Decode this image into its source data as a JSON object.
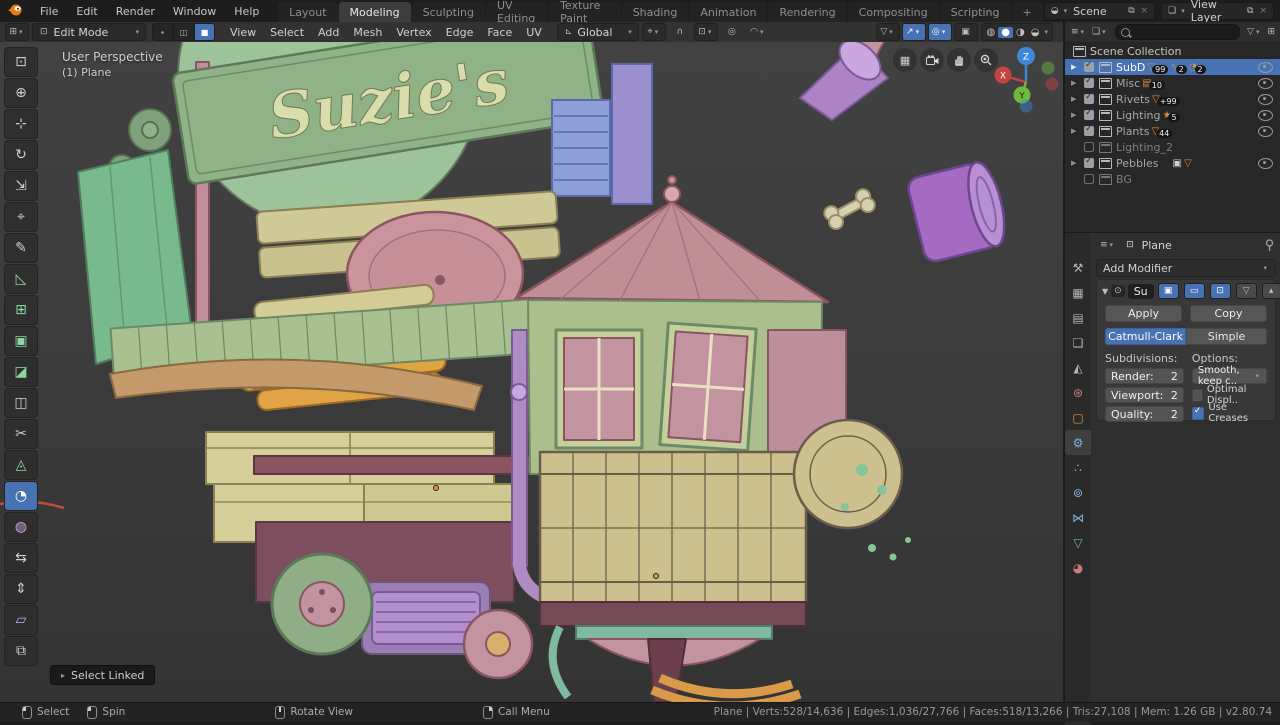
{
  "topbar": {
    "menus": [
      "File",
      "Edit",
      "Render",
      "Window",
      "Help"
    ],
    "tabs": [
      "Layout",
      "Modeling",
      "Sculpting",
      "UV Editing",
      "Texture Paint",
      "Shading",
      "Animation",
      "Rendering",
      "Compositing",
      "Scripting",
      "+"
    ],
    "active_tab": "Modeling",
    "scene_label": "Scene",
    "view_layer_label": "View Layer"
  },
  "viewport_header": {
    "mode": "Edit Mode",
    "menus": [
      "View",
      "Select",
      "Add",
      "Mesh",
      "Vertex",
      "Edge",
      "Face",
      "UV"
    ],
    "orientation": "Global"
  },
  "toolbar": {
    "tools": [
      {
        "n": "select-box",
        "g": "⊡"
      },
      {
        "n": "cursor",
        "g": "⊕"
      },
      {
        "n": "move",
        "g": "⊹"
      },
      {
        "n": "rotate",
        "g": "↻"
      },
      {
        "n": "scale",
        "g": "⇲"
      },
      {
        "n": "transform",
        "g": "⌖"
      },
      {
        "n": "annotate",
        "g": "✎"
      },
      {
        "n": "measure",
        "g": "◺"
      },
      {
        "n": "extrude-region",
        "g": "⊞"
      },
      {
        "n": "inset-faces",
        "g": "▣"
      },
      {
        "n": "bevel",
        "g": "◪"
      },
      {
        "n": "loop-cut",
        "g": "◫"
      },
      {
        "n": "knife",
        "g": "✂"
      },
      {
        "n": "poly-build",
        "g": "◬"
      },
      {
        "n": "spin",
        "g": "◔"
      },
      {
        "n": "smooth",
        "g": "◍"
      },
      {
        "n": "edge-slide",
        "g": "⇆"
      },
      {
        "n": "shrink-fatten",
        "g": "⇕"
      },
      {
        "n": "shear",
        "g": "▱"
      },
      {
        "n": "rip-region",
        "g": "⧉"
      }
    ],
    "active_tool": "spin"
  },
  "viewport": {
    "persp_label": "User Perspective",
    "object_label": "(1) Plane",
    "operator_label": "Select Linked",
    "sign_text": "Suzie's",
    "gizmo": {
      "x": "X",
      "y": "Y",
      "z": "Z"
    }
  },
  "outliner": {
    "root": "Scene Collection",
    "items": [
      {
        "name": "SubD",
        "badges": [
          {
            "g": "▽",
            "c": "99"
          },
          {
            "g": "∿",
            "c": "2"
          },
          {
            "g": "◔",
            "c": "2"
          }
        ]
      },
      {
        "name": "Misc",
        "badges": [
          {
            "g": "▤",
            "c": "10"
          }
        ]
      },
      {
        "name": "Rivets",
        "badges": [
          {
            "g": "▽",
            "c": "+99"
          }
        ]
      },
      {
        "name": "Lighting",
        "badges": [
          {
            "g": "★",
            "c": "5"
          }
        ]
      },
      {
        "name": "Plants",
        "badges": [
          {
            "g": "▽",
            "c": "44"
          }
        ]
      },
      {
        "name": "Lighting_2",
        "badges": []
      },
      {
        "name": "Pebbles",
        "badges": [
          {
            "g": "▣",
            "c": ""
          },
          {
            "g": "▽",
            "c": ""
          }
        ]
      },
      {
        "name": "BG",
        "badges": []
      }
    ]
  },
  "properties": {
    "breadcrumb": "Plane",
    "add_modifier": "Add Modifier",
    "modifier": {
      "name": "Su",
      "apply": "Apply",
      "copy": "Copy",
      "type_a": "Catmull-Clark",
      "type_b": "Simple",
      "subdiv_label": "Subdivisions:",
      "options_label": "Options:",
      "render_label": "Render:",
      "render_value": "2",
      "viewport_label": "Viewport:",
      "viewport_value": "2",
      "quality_label": "Quality:",
      "quality_value": "2",
      "uv_smooth": "Smooth, keep c..",
      "optimal_display": "Optimal Displ..",
      "use_creases": "Use Creases"
    },
    "tabs": [
      {
        "n": "tool",
        "g": "⚒"
      },
      {
        "n": "render",
        "g": "▦"
      },
      {
        "n": "output",
        "g": "▤"
      },
      {
        "n": "view-layer",
        "g": "❏"
      },
      {
        "n": "scene",
        "g": "◭"
      },
      {
        "n": "world",
        "g": "⊛"
      },
      {
        "n": "object",
        "g": "▢"
      },
      {
        "n": "modifiers",
        "g": "⚙"
      },
      {
        "n": "particles",
        "g": "∴"
      },
      {
        "n": "physics",
        "g": "⊚"
      },
      {
        "n": "constraints",
        "g": "⋈"
      },
      {
        "n": "object-data",
        "g": "▽"
      },
      {
        "n": "material",
        "g": "◕"
      }
    ]
  },
  "statusbar": {
    "select": "Select",
    "spin": "Spin",
    "rotate_view": "Rotate View",
    "call_menu": "Call Menu",
    "stats": "Plane | Verts:528/14,636 | Edges:1,036/27,766 | Faces:518/13,266 | Tris:27,108 | Mem: 1.26 GB | v2.80.74"
  },
  "colors": {
    "accent": "#4772b3",
    "outliner_orange": "#d98d3e",
    "sign_green": "#8fb287",
    "tower_pink": "#c08f96"
  }
}
